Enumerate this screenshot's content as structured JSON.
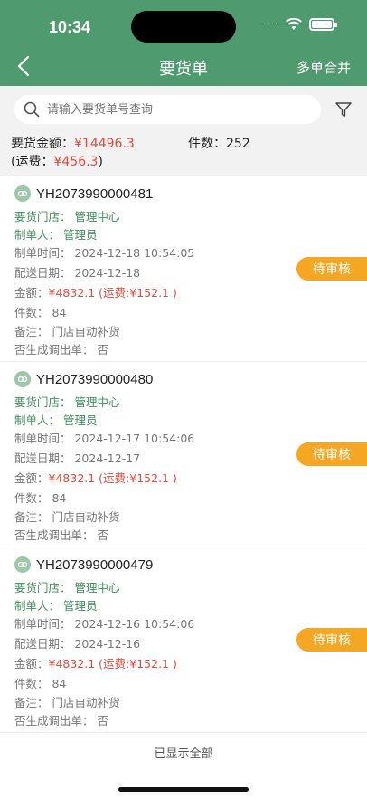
{
  "status_bar": {
    "time": "10:34",
    "dots": "····"
  },
  "nav": {
    "title": "要货单",
    "right_action": "多单合并"
  },
  "search": {
    "placeholder": "请输入要货单号查询"
  },
  "summary": {
    "amount_label": "要货金额：",
    "amount_value": "¥14496.3",
    "pieces_label": "件数：",
    "pieces_value": "252",
    "freight_prefix": "(运费：",
    "freight_value": "¥456.3",
    "freight_suffix": ")"
  },
  "orders": [
    {
      "no": "YH2073990000481",
      "store": "要货门店：  管理中心",
      "creator": "制单人：  管理员",
      "created_time": "制单时间：  2024-12-18 10:54:05",
      "delivery_date": "配送日期：  2024-12-18",
      "amount_label": "金额：",
      "amount": "¥4832.1  (运费:¥152.1 )",
      "pieces": "件数：  84",
      "remark": "备注：  门店自动补货",
      "transfer": "否生成调出单：  否",
      "status": "待审核"
    },
    {
      "no": "YH2073990000480",
      "store": "要货门店：  管理中心",
      "creator": "制单人：  管理员",
      "created_time": "制单时间：  2024-12-17 10:54:06",
      "delivery_date": "配送日期：  2024-12-17",
      "amount_label": "金额：",
      "amount": "¥4832.1  (运费:¥152.1 )",
      "pieces": "件数：  84",
      "remark": "备注：  门店自动补货",
      "transfer": "否生成调出单：  否",
      "status": "待审核"
    },
    {
      "no": "YH2073990000479",
      "store": "要货门店：  管理中心",
      "creator": "制单人：  管理员",
      "created_time": "制单时间：  2024-12-16 10:54:06",
      "delivery_date": "配送日期：  2024-12-16",
      "amount_label": "金额：",
      "amount": "¥4832.1  (运费:¥152.1 )",
      "pieces": "件数：  84",
      "remark": "备注：  门店自动补货",
      "transfer": "否生成调出单：  否",
      "status": "待审核"
    }
  ],
  "footer": {
    "text": "已显示全部"
  },
  "colors": {
    "header": "#4f9a6f",
    "accent_red": "#e24a3b",
    "status_orange": "#f5a623",
    "label_green": "#3f8f5d"
  }
}
